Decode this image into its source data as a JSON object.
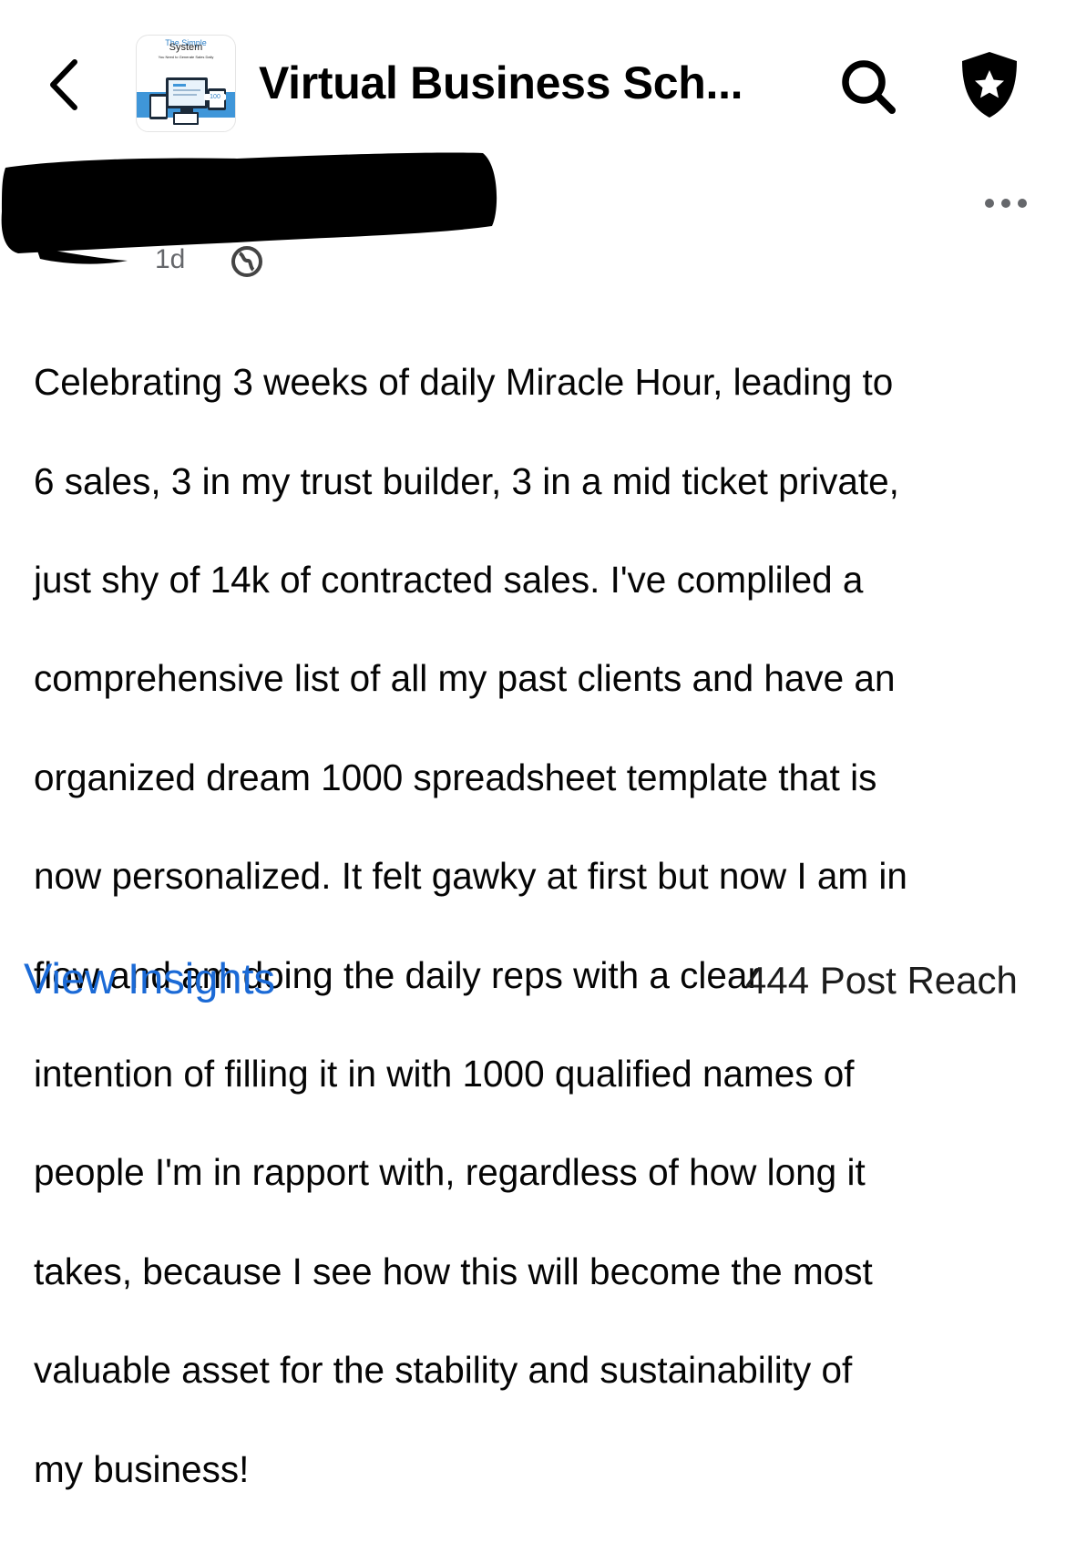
{
  "header": {
    "back_icon": "chevron-left-icon",
    "group_title": "Virtual Business Sch...",
    "thumbnail": {
      "top_text": "The Simple",
      "system_text": "System",
      "sub_text": "You Need to Generate Sales Daily",
      "badge_text": "100"
    },
    "search_icon": "search-icon",
    "admin_icon": "shield-star-icon"
  },
  "post": {
    "time_fragment": "1d",
    "privacy_icon": "globe-icon",
    "more_icon": "more-dots-icon",
    "body_lines": [
      "Celebrating 3 weeks of daily Miracle Hour, leading to",
      "6 sales, 3 in my trust builder, 3 in a mid ticket private,",
      "just shy of 14k of contracted sales. I've compliled a",
      "comprehensive list of all my past clients and have an",
      "organized dream 1000 spreadsheet template that is",
      "now personalized. It felt gawky at first but now I am in",
      "flow and am doing the daily reps with a clear",
      "intention of filling it in with 1000 qualified names of",
      "people I'm in rapport with, regardless of how long it",
      "takes, because I see how this will become the most",
      "valuable asset for the stability and sustainability of",
      "my business!"
    ]
  },
  "footer": {
    "view_insights": "View Insights",
    "post_reach": "444 Post Reach"
  },
  "colors": {
    "link": "#1b6ad6",
    "text": "#050505",
    "muted": "#65676b",
    "redaction": "#000000"
  }
}
